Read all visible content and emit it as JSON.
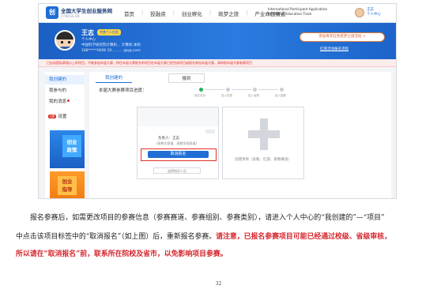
{
  "nav": {
    "brand": "全国大学生创业服务网",
    "brand_sub": "CY.NCSS.CN",
    "menu": [
      "首页",
      "投融资",
      "创业孵化",
      "筑梦之旅",
      "产业命题赛道"
    ],
    "intl_line1": "International Participant Application",
    "intl_line2": "for Higher Education Track",
    "user_name": "王志",
    "user_sub": "个人中心"
  },
  "hero": {
    "name": "王志",
    "badge": "完善个人信息",
    "sub": "个人中心",
    "school": "中国科学研究院计算机…   计算机   本科",
    "contact": "188*****0006   50……… @qq.com",
    "cta_button": "参加青年红色筑梦之旅活动 >",
    "link": "红旅活动报名流程"
  },
  "notice": {
    "text": "已启动国际赛道以上的项目，不能参加本届大赛，抓住本届大赛报名的项目在本届大赛已经完成项目或报名参加本届大赛，请申报本届大赛参赛项目",
    "right": "红旅活动报名流程"
  },
  "sidebar": {
    "items": [
      "我创建的",
      "我参与的",
      "我的消息"
    ],
    "settings": "设置",
    "vip": "VIP",
    "banner1": [
      "创业",
      "政策"
    ],
    "banner2": [
      "创业",
      "指导"
    ]
  },
  "main": {
    "tab_mine": "我创建的",
    "tab_join": "报到",
    "progress_label": "本届大赛参赛项目进度：",
    "steps": [
      "报名成功",
      "进入校赛",
      "进入省赛",
      "进入国赛"
    ],
    "card": {
      "lead": "负责人：王志",
      "track": "(高教主赛道、高教学校赛道)",
      "cancel": "取消报名",
      "teacher": "选择指导人员"
    },
    "create_label": "创建项目（高教、红旅、职教赛道）"
  },
  "body": {
    "line1": "报名参赛后，如需更改项目的参赛信息（参赛赛道、参赛组别、参赛类别），请进入个人中心的“我创建的”—“项目”",
    "line2_normal": "中点击该项目标签中的“取消报名”（如上图）后，重新报名参赛。",
    "line2_red": "请注意，已报名参赛项目可能已经通过校级、省级审核，",
    "line3_red": "所以请在“取消报名”前，联系所在院校及省市，以免影响项目参赛。",
    "page_number": "32"
  },
  "colors": {
    "brand_blue": "#1f6ed4",
    "warning_red": "#d4232a",
    "step_done": "#21b45a"
  }
}
